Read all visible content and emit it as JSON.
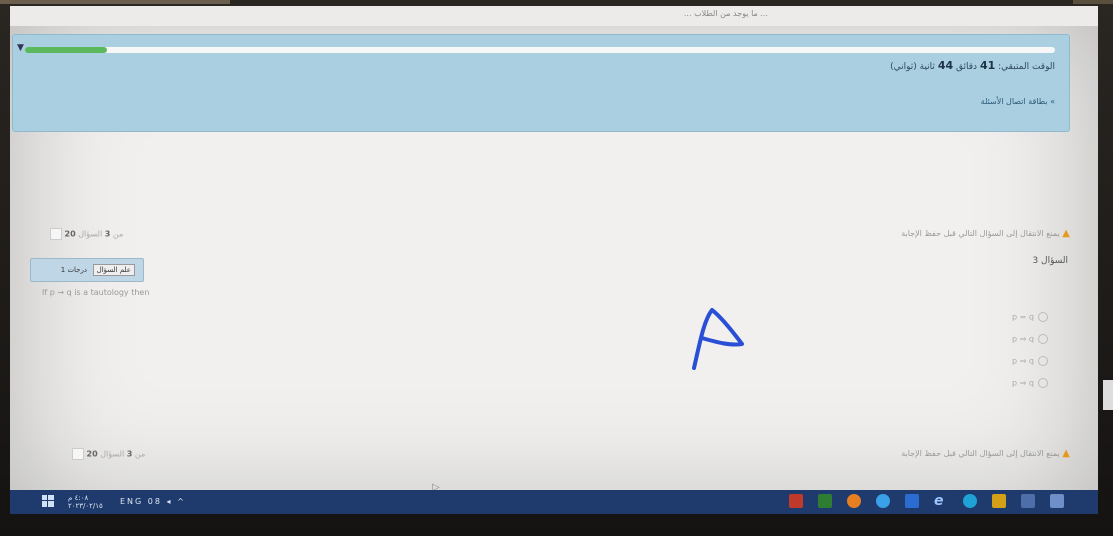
{
  "top_strip": {
    "text": "... ما يوجد من الطلاب ..."
  },
  "timer": {
    "prefix": "الوقت المتبقي:",
    "minutes": "41",
    "minutes_label": "دقائق",
    "seconds": "44",
    "seconds_label": "ثانية (ثواني)",
    "progress_percent": 8
  },
  "question_nav_link": "» بطاقة اتصال الأسئلة",
  "warning_text": "يمنع الانتقال إلى السؤال التالي قبل حفظ الإجابة",
  "nav_top": {
    "label": "السؤال",
    "current": "3",
    "of": "من",
    "total": "20"
  },
  "nav_bottom": {
    "label": "السؤال",
    "current": "3",
    "of": "من",
    "total": "20"
  },
  "question_number": "السؤال 3",
  "marks_box": {
    "mark": "1 درجات",
    "flag": "علم السؤال"
  },
  "question_text": "If p → q is a tautology then",
  "options": [
    "p = q",
    "p ⇒ q",
    "p ⇒ q",
    "p ⇒ q"
  ],
  "handwritten_answer": "A",
  "taskbar": {
    "time": "٤:٠٨ م",
    "date": "٢٠٢٣/٠٢/١٥",
    "tray": "ENG 08 ◂ ^"
  },
  "colors": {
    "panel": "#a9cfe1",
    "progress": "#5cb85c",
    "taskbar": "#1f3b6d",
    "ink": "#2a4fd6",
    "warning": "#e69a1d"
  }
}
